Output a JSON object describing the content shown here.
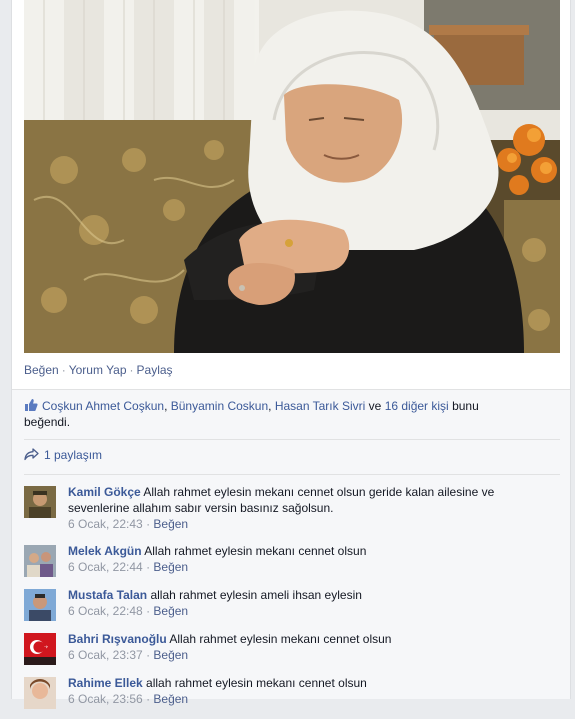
{
  "post": {
    "actions": {
      "like": "Beğen",
      "comment": "Yorum Yap",
      "share": "Paylaş",
      "separator": "·"
    }
  },
  "likes": {
    "people": [
      "Coşkun Ahmet Coşkun",
      "Bünyamin Coskun",
      "Hasan Tarık Sivri"
    ],
    "comma": ",",
    "connector": "ve",
    "others": "16 diğer kişi",
    "suffix": "bunu beğendi."
  },
  "shares": {
    "label": "1 paylaşım"
  },
  "comments": [
    {
      "name": "Kamil Gökçe",
      "text": "Allah rahmet eylesin mekanı cennet olsun geride kalan ailesine ve sevenlerine allahım sabır versin basınız sağolsun.",
      "time": "6 Ocak, 22:43",
      "like": "Beğen",
      "sep": "·"
    },
    {
      "name": "Melek Akgün",
      "text": "Allah rahmet eylesin mekanı cennet olsun",
      "time": "6 Ocak, 22:44",
      "like": "Beğen",
      "sep": "·"
    },
    {
      "name": "Mustafa Talan",
      "text": "allah rahmet eylesin ameli ihsan eylesin",
      "time": "6 Ocak, 22:48",
      "like": "Beğen",
      "sep": "·"
    },
    {
      "name": "Bahri Rışvanoğlu",
      "text": "Allah rahmet eylesin mekanı cennet olsun",
      "time": "6 Ocak, 23:37",
      "like": "Beğen",
      "sep": "·"
    },
    {
      "name": "Rahime Ellek",
      "text": "allah rahmet eylesin mekanı cennet olsun",
      "time": "6 Ocak, 23:56",
      "like": "Beğen",
      "sep": "·"
    }
  ],
  "colors": {
    "link": "#3b5998",
    "action": "#4b5e8c",
    "meta": "#9197a3",
    "ufi_bg": "#f6f7f9"
  },
  "icons": {
    "like": "thumbs-up-icon",
    "share": "share-arrow-icon"
  }
}
